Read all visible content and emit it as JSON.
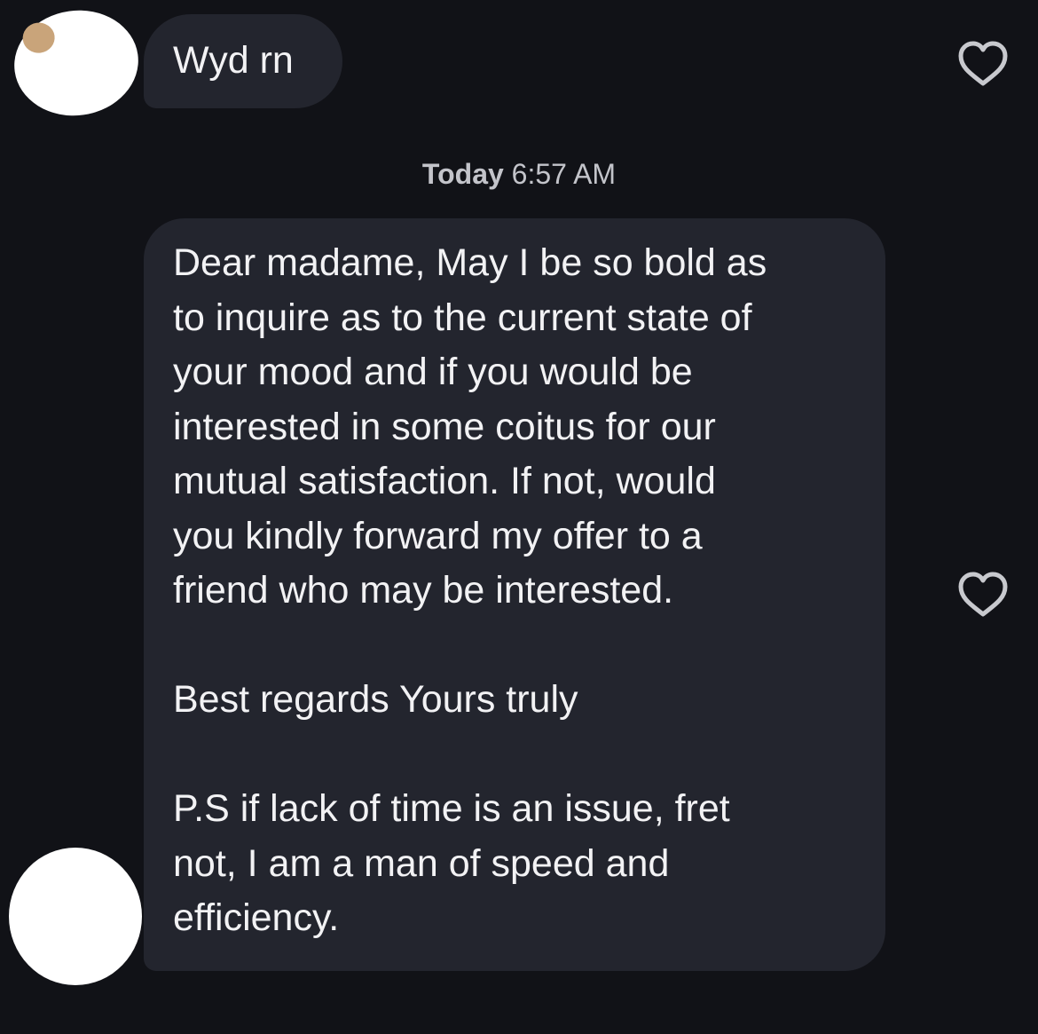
{
  "thread": {
    "messages": [
      {
        "sender": "other",
        "lines": [
          "Wyd rn"
        ]
      },
      {
        "sender": "other",
        "lines": [
          "Dear madame, May I be so bold as",
          "to inquire as to the current state of",
          "your mood and if you would be",
          "interested in some coitus for our",
          "mutual satisfaction. If not, would",
          "you kindly forward my offer to a",
          "friend who may be interested.",
          "",
          "Best regards Yours truly",
          "",
          "P.S if lack of time is an issue, fret",
          "not, I am a man of speed and",
          "efficiency."
        ]
      }
    ],
    "timestamp": {
      "day": "Today",
      "time": "6:57 AM"
    }
  },
  "icons": {
    "like": "heart-outline-icon"
  },
  "colors": {
    "background": "#111217",
    "bubble": "#23252e",
    "text": "#f2f2f4",
    "timestamp": "#c3c4ca",
    "icon": "#c8c9ce"
  }
}
